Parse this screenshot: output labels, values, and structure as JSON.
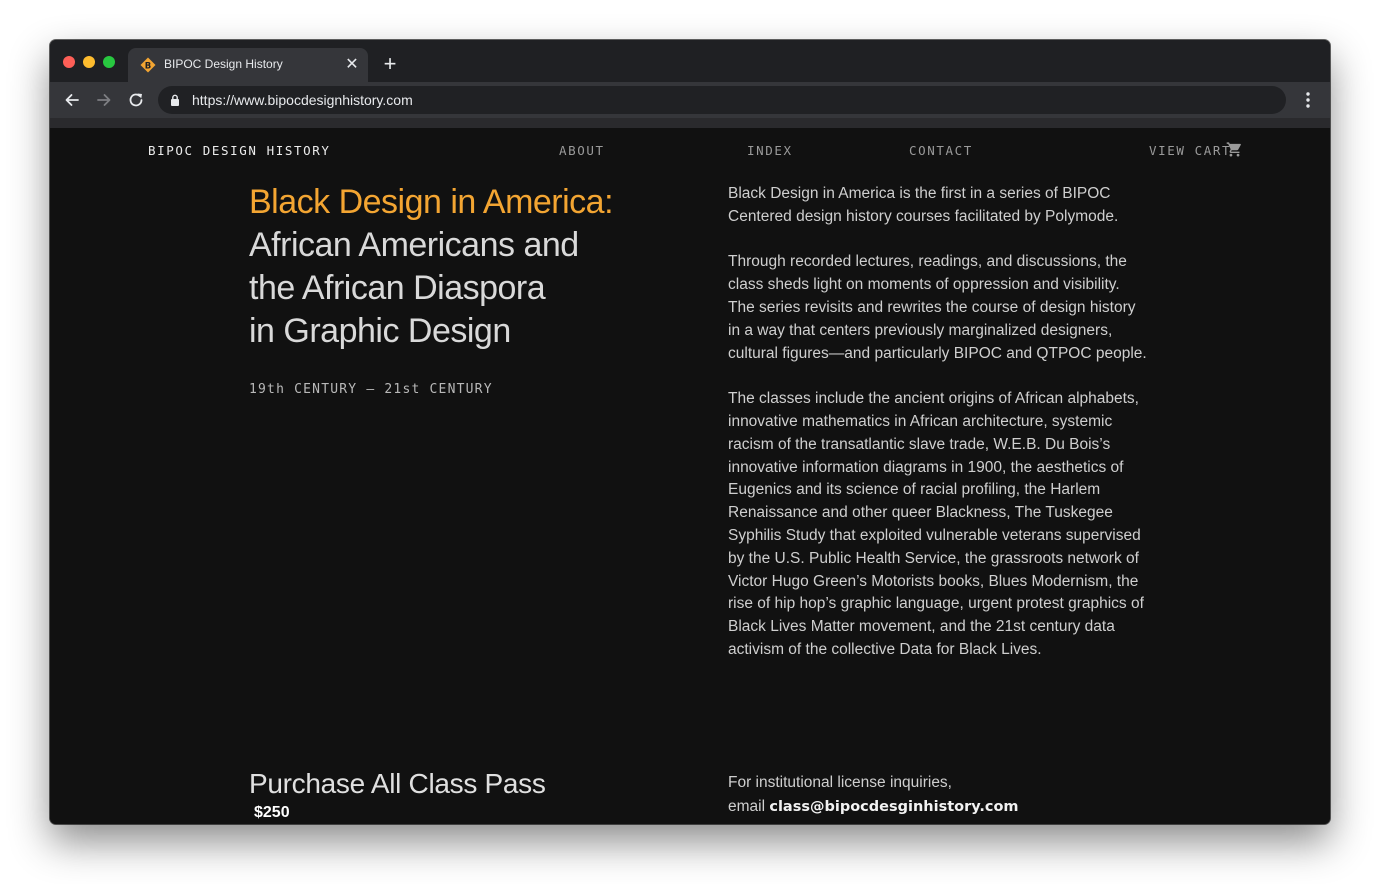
{
  "browser": {
    "tab_title": "BIPOC Design History",
    "url": "https://www.bipocdesignhistory.com",
    "favicon_letter": "B",
    "favicon_color": "#f3a532"
  },
  "site": {
    "brand": "BIPOC DESIGN HISTORY",
    "nav": {
      "about": "ABOUT",
      "index": "INDEX",
      "contact": "CONTACT",
      "cart": "VIEW CART"
    }
  },
  "hero": {
    "title_accent": "Black Design in America:",
    "title_line2": "African Americans and",
    "title_line3": "the African Diaspora",
    "title_line4": "in Graphic Design",
    "dates": "19th CENTURY – 21st CENTURY"
  },
  "description": {
    "p1": "Black Design in America is the first in a series of BIPOC Centered design history courses facilitated by Polymode.",
    "p2": "Through recorded lectures, readings, and discussions, the class sheds light on moments of oppression and visibility. The series revisits and rewrites the course of design history in a way that centers previously marginalized designers, cultural figures—and particularly BIPOC and QTPOC people.",
    "p3": "The classes include the ancient origins of African alphabets, innovative mathematics in African architecture, systemic racism of the transatlantic slave trade, W.E.B. Du Bois’s innovative information diagrams in 1900, the aesthetics of Eugenics and its science of racial profiling, the Harlem Renaissance and other queer Blackness, The Tuskegee Syphilis Study that exploited vulnerable veterans supervised by the U.S. Public Health Service, the grassroots network of Victor Hugo Green’s Motorists books, Blues Modernism, the rise of hip hop’s graphic language, urgent protest graphics of Black Lives Matter movement, and the 21st century data activism of the collective Data for Black Lives."
  },
  "purchase": {
    "title": "Purchase All Class Pass",
    "price": "$250"
  },
  "license": {
    "line1": "For institutional license inquiries,",
    "email_prefix": "email",
    "email": "class@bipocdesginhistory.com"
  },
  "colors": {
    "accent": "#f3a532",
    "page_bg": "#111111"
  }
}
